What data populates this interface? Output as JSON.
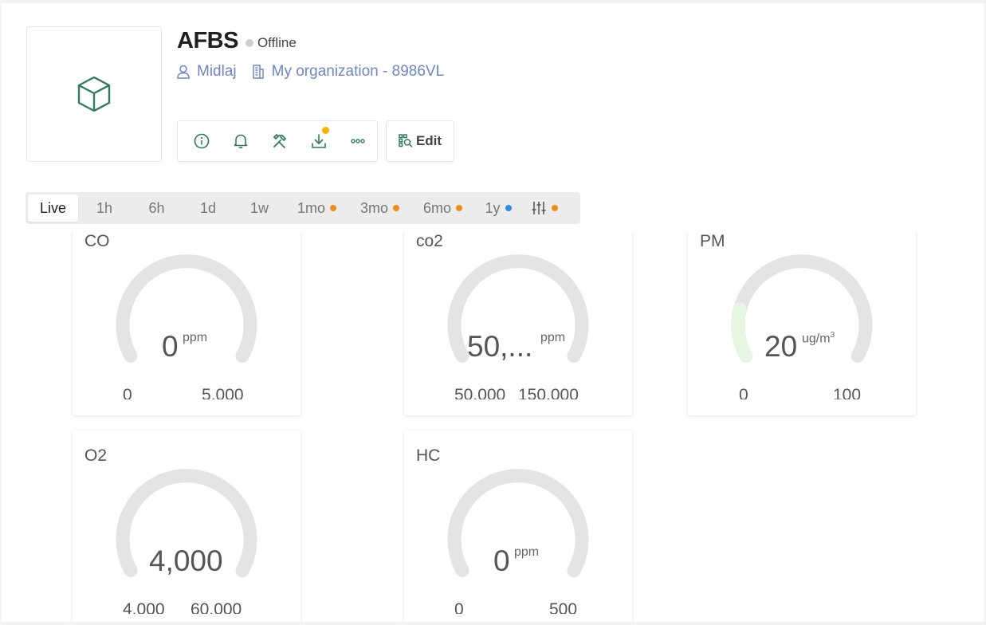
{
  "device": {
    "title": "AFBS",
    "status": "Offline",
    "owner": "Midlaj",
    "organization": "My organization - 8986VL"
  },
  "toolbar": {
    "icons": [
      "info-icon",
      "bell-icon",
      "tools-icon",
      "download-icon",
      "more-icon"
    ],
    "edit_label": "Edit"
  },
  "tabs": [
    {
      "label": "Live",
      "active": true
    },
    {
      "label": "1h"
    },
    {
      "label": "6h"
    },
    {
      "label": "1d"
    },
    {
      "label": "1w"
    },
    {
      "label": "1mo",
      "dot": "#f08c1a"
    },
    {
      "label": "3mo",
      "dot": "#f08c1a"
    },
    {
      "label": "6mo",
      "dot": "#f08c1a"
    },
    {
      "label": "1y",
      "dot": "#2b8be6"
    },
    {
      "label": "",
      "icon": "sliders-icon",
      "dot": "#f08c1a"
    }
  ],
  "colors": {
    "accent": "#2e7d5b",
    "link": "#6e86c6",
    "gauge_track": "#e4e4e4",
    "gauge_fill": "#e6f6e0"
  },
  "widgets": {
    "co": {
      "title": "CO",
      "value": "0",
      "unit": "ppm",
      "min": "0",
      "max": "5,000",
      "fill_fraction": 0
    },
    "co2": {
      "title": "co2",
      "value": "50,...",
      "unit": "ppm",
      "min": "50,000",
      "max": "150,000",
      "fill_fraction": 0
    },
    "pm": {
      "title": "PM",
      "value": "20",
      "unit": "ug/m",
      "unit_sup": "3",
      "min": "0",
      "max": "100",
      "fill_fraction": 0.2
    },
    "o2": {
      "title": "O2",
      "value": "4,000",
      "unit": "",
      "min": "4,000",
      "max": "60,000",
      "fill_fraction": 0
    },
    "hc": {
      "title": "HC",
      "value": "0",
      "unit": "ppm",
      "min": "0",
      "max": "500",
      "fill_fraction": 0
    }
  }
}
